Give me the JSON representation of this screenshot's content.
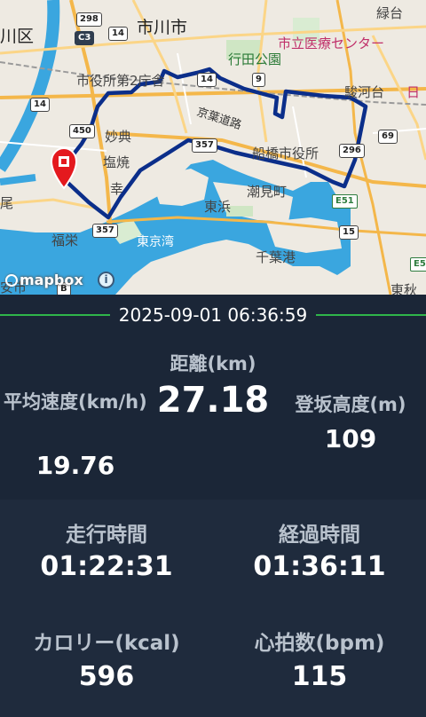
{
  "map": {
    "place_labels": {
      "ichikawa_city": "市川市",
      "ward": "川区",
      "ryokudai": "緑台",
      "hospital": "市立医療センター",
      "gyoda_park": "行田公園",
      "city_office_2": "市役所第2庁舎",
      "keiyo_road": "京葉道路",
      "surugadai": "駿河台",
      "myoden": "妙典",
      "funabashi_city_office": "船橋市役所",
      "shioyaki": "塩焼",
      "saiwai": "幸",
      "shiomicho": "潮見町",
      "tokyo_bay": "東京湾",
      "higashihama": "東浜",
      "chiba_port": "千葉港",
      "fukuei": "福栄",
      "o": "尾",
      "hi": "日",
      "ansei": "安市",
      "sekimo": "東秋"
    },
    "shields": [
      "298",
      "C3",
      "14",
      "14",
      "9",
      "69",
      "296",
      "450",
      "357",
      "357",
      "E51",
      "14",
      "15",
      "E5",
      "B"
    ],
    "attribution": "mapbox",
    "info_icon": "info-icon",
    "route_color": "#0b2e8a",
    "marker_color": "#e4191e"
  },
  "summary": {
    "date": "2025-09-01 06:36:59",
    "distance_label": "距離(km)",
    "distance_value": "27.18",
    "avg_speed_label": "平均速度(km/h)",
    "avg_speed_value": "19.76",
    "elevation_label": "登坂高度(m)",
    "elevation_value": "109",
    "ride_time_label": "走行時間",
    "ride_time_value": "01:22:31",
    "elapsed_label": "経過時間",
    "elapsed_value": "01:36:11",
    "calories_label": "カロリー(kcal)",
    "calories_value": "596",
    "heart_rate_label": "心拍数(bpm)",
    "heart_rate_value": "115"
  },
  "colors": {
    "accent_line": "#2fb54a",
    "panel_top": "#1b2637",
    "panel_bottom": "#1f2b3d"
  }
}
